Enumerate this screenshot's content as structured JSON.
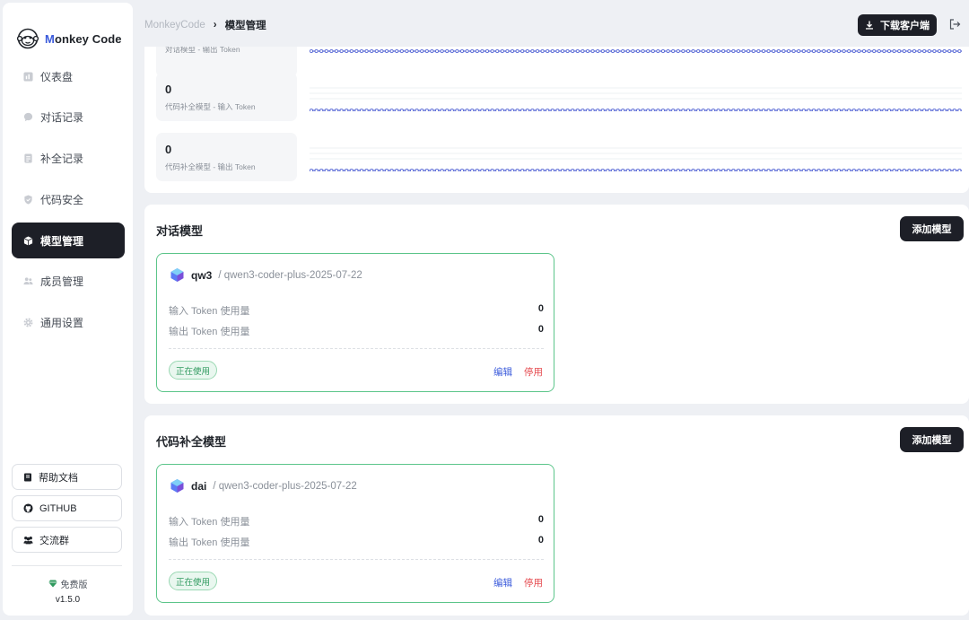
{
  "app": {
    "logo_text_prefix": "M",
    "logo_text_rest": "onkey Code"
  },
  "sidebar": {
    "items": [
      {
        "label": "仪表盘",
        "icon": "dashboard-icon",
        "active": false
      },
      {
        "label": "对话记录",
        "icon": "chat-icon",
        "active": false
      },
      {
        "label": "补全记录",
        "icon": "document-icon",
        "active": false
      },
      {
        "label": "代码安全",
        "icon": "shield-icon",
        "active": false
      },
      {
        "label": "模型管理",
        "icon": "cube-icon",
        "active": true
      },
      {
        "label": "成员管理",
        "icon": "users-icon",
        "active": false
      },
      {
        "label": "通用设置",
        "icon": "gear-icon",
        "active": false
      }
    ],
    "buttons": [
      {
        "label": "帮助文档",
        "icon": "book-icon"
      },
      {
        "label": "GITHUB",
        "icon": "github-icon"
      },
      {
        "label": "交流群",
        "icon": "group-icon"
      }
    ],
    "plan": {
      "name": "免费版",
      "version": "v1.5.0"
    }
  },
  "header": {
    "breadcrumb_root": "MonkeyCode",
    "breadcrumb_sep": "›",
    "breadcrumb_current": "模型管理",
    "download_label": "下载客户端"
  },
  "token_stats": [
    {
      "value": "",
      "label": "对话模型 - 输出 Token"
    },
    {
      "value": "0",
      "label": "代码补全模型 - 输入 Token"
    },
    {
      "value": "0",
      "label": "代码补全模型 - 输出 Token"
    }
  ],
  "chat_models": {
    "title": "对话模型",
    "add_label": "添加模型",
    "cards": [
      {
        "name": "qw3",
        "model_id": "/ qwen3-coder-plus-2025-07-22",
        "input_label": "输入 Token 使用量",
        "input_value": "0",
        "output_label": "输出 Token 使用量",
        "output_value": "0",
        "status": "正在使用",
        "edit": "编辑",
        "stop": "停用"
      }
    ]
  },
  "completion_models": {
    "title": "代码补全模型",
    "add_label": "添加模型",
    "cards": [
      {
        "name": "dai",
        "model_id": "/ qwen3-coder-plus-2025-07-22",
        "input_label": "输入 Token 使用量",
        "input_value": "0",
        "output_label": "输出 Token 使用量",
        "output_value": "0",
        "status": "正在使用",
        "edit": "编辑",
        "stop": "停用"
      }
    ]
  },
  "colors": {
    "accent": "#3b5bdb",
    "dark": "#1d1f27",
    "success": "#2f9a5e",
    "danger": "#e5484d",
    "card_border": "#5cc58a"
  }
}
